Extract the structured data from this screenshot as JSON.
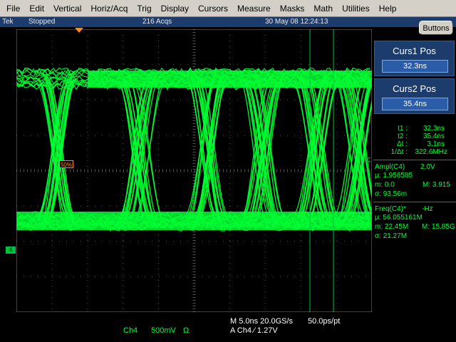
{
  "menu": [
    "File",
    "Edit",
    "Vertical",
    "Horiz/Acq",
    "Trig",
    "Display",
    "Cursors",
    "Measure",
    "Masks",
    "Math",
    "Utilities",
    "Help"
  ],
  "status": {
    "brand": "Tek",
    "state": "Stopped",
    "acqs": "216 Acqs",
    "datetime": "30 May 08 12:24:13"
  },
  "buttons_label": "Buttons",
  "curs1": {
    "title": "Curs1 Pos",
    "value": "32.3ns"
  },
  "curs2": {
    "title": "Curs2 Pos",
    "value": "35.4ns"
  },
  "cursor_readout": {
    "t1_label": "t1 :",
    "t1": "32.3ns",
    "t2_label": "t2 :",
    "t2": "35.4ns",
    "dt_label": "Δt :",
    "dt": "3.1ns",
    "inv_label": "1/Δt :",
    "inv": "322.6MHz"
  },
  "ampl": {
    "label": "Ampl(C4)",
    "unit": "2.0V",
    "mu": "μ: 1.958585",
    "m": "m: 0.0",
    "M": "M: 3.915",
    "sigma": "σ: 93.56m"
  },
  "freq": {
    "label": "Freq(C4)*",
    "unit": "-Hz",
    "mu": "μ: 56.055161M",
    "m": "m: 22.45M",
    "M": "M: 15.85G",
    "sigma": "σ: 21.27M"
  },
  "trig_marker": "50%",
  "ch_marker": "4",
  "bottom": {
    "timebase": "M 5.0ns 20.0GS/s",
    "ptpt": "50.0ps/pt",
    "trig_line": "A  Ch4  ∕  1.27V",
    "ch": "Ch4",
    "volts": "500mV",
    "omega": "Ω"
  },
  "colors": {
    "trace": "#00ff33",
    "grid": "#505050",
    "panel": "#1c3c6e",
    "cursor": "#00c040"
  }
}
